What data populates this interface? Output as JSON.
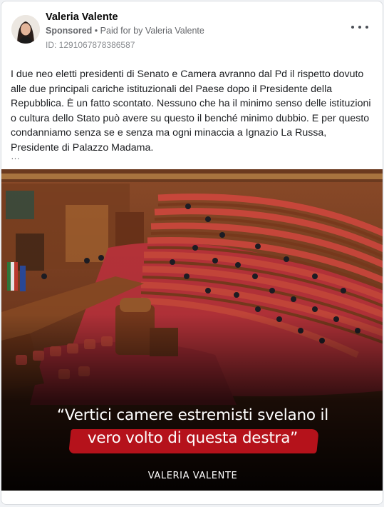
{
  "post": {
    "author": "Valeria Valente",
    "sponsored": "Sponsored",
    "separator": "•",
    "paid_for": "Paid for by",
    "payer": "Valeria Valente",
    "id_label": "ID: 1291067878386587",
    "body": "I due neo eletti presidenti di Senato e Camera avranno dal Pd il rispetto dovuto alle due principali cariche istituzionali del Paese dopo il Presidente della Repubblica. È un fatto scontato. Nessuno che ha il minimo senso delle istituzioni o cultura dello Stato può avere su questo il benché minimo dubbio. E per questo condanniamo senza se e senza ma ogni minaccia a Ignazio La Russa, Presidente di Palazzo Madama.",
    "see_more": "…",
    "more_icon": "more-horizontal-icon"
  },
  "creative": {
    "quote_line1": "“Vertici camere estremisti svelano il",
    "quote_line2": "vero volto di questa destra”",
    "brand": "VALERIA VALENTE",
    "accent_color": "#b5121b",
    "seat_color": "#c9473b",
    "wood_color": "#7a3a1d"
  }
}
